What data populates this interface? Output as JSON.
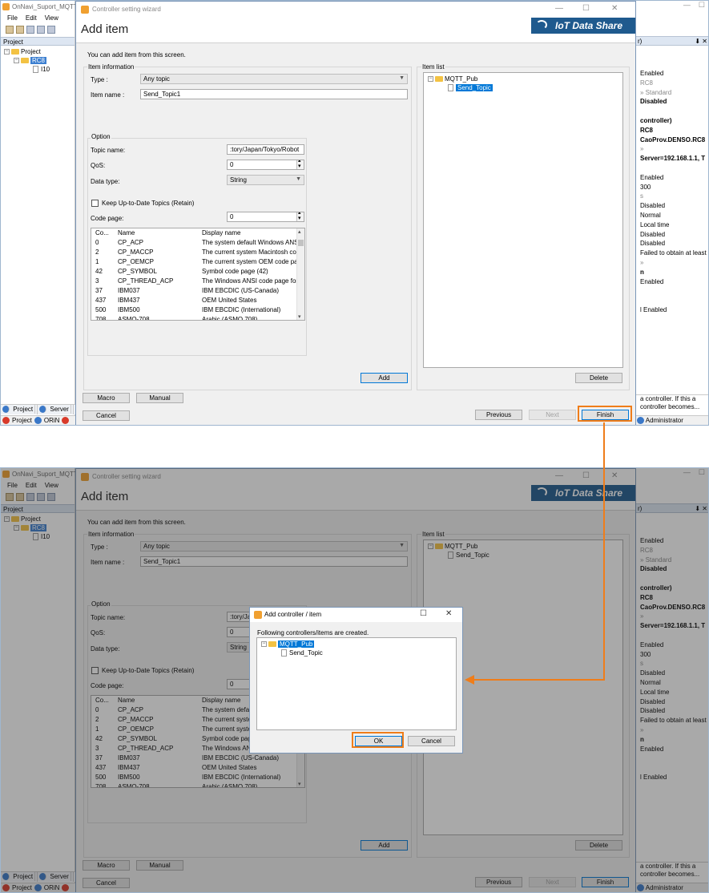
{
  "app": {
    "title": "OnNavi_Suport_MQTT",
    "menu": [
      "File",
      "Edit",
      "View"
    ],
    "project_panel_title": "Project",
    "tree": {
      "root": "Project",
      "controller": "RC8",
      "child": "I10"
    },
    "bottom_tabs": [
      "Project",
      "Server"
    ],
    "status": [
      "Project",
      "ORiN"
    ]
  },
  "props": {
    "title_suffix": "r)",
    "pin": "⬇ ✕",
    "rows": [
      {
        "text": "Enabled",
        "style": ""
      },
      {
        "text": "RC8",
        "style": "g"
      },
      {
        "text": "» Standard",
        "style": "g"
      },
      {
        "text": "Disabled",
        "style": "b"
      },
      {
        "text": "",
        "style": ""
      },
      {
        "text": "controller)",
        "style": "b"
      },
      {
        "text": "RC8",
        "style": "b"
      },
      {
        "text": "CaoProv.DENSO.RC8",
        "style": "b"
      },
      {
        "text": "»",
        "style": "g"
      },
      {
        "text": "Server=192.168.1.1, T",
        "style": "b"
      },
      {
        "text": "",
        "style": ""
      },
      {
        "text": "Enabled",
        "style": ""
      },
      {
        "text": "300",
        "style": ""
      },
      {
        "text": "s",
        "style": "g"
      },
      {
        "text": "Disabled",
        "style": ""
      },
      {
        "text": "Normal",
        "style": ""
      },
      {
        "text": "Local time",
        "style": ""
      },
      {
        "text": "Disabled",
        "style": ""
      },
      {
        "text": "Disabled",
        "style": ""
      },
      {
        "text": "Failed to obtain at least",
        "style": ""
      },
      {
        "text": "»",
        "style": "g"
      },
      {
        "text": "n",
        "style": "b"
      },
      {
        "text": "Enabled",
        "style": ""
      },
      {
        "text": "",
        "style": ""
      },
      {
        "text": "",
        "style": ""
      },
      {
        "text": "l Enabled",
        "style": ""
      }
    ],
    "desc": "a controller. If this a controller becomes...",
    "status": "Administrator"
  },
  "wizard": {
    "title": "Controller setting wizard",
    "heading": "Add item",
    "logo": "IoT Data Share",
    "intro": "You can add item from this screen.",
    "item_info_label": "Item information",
    "type_label": "Type :",
    "type_value": "Any topic",
    "item_name_label": "Item name :",
    "item_name_value": "Send_Topic1",
    "option_label": "Option",
    "topic_name_label": "Topic name:",
    "topic_name_value": ":tory/Japan/Tokyo/Robot",
    "qos_label": "QoS:",
    "qos_value": "0",
    "data_type_label": "Data type:",
    "data_type_value": "String",
    "retain_label": "Keep Up-to-Date Topics (Retain)",
    "code_page_label": "Code page:",
    "code_page_value": "0",
    "code_list": {
      "columns": [
        "Co...",
        "Name",
        "Display name"
      ],
      "rows": [
        [
          "0",
          "CP_ACP",
          "The system default Windows ANSI"
        ],
        [
          "2",
          "CP_MACCP",
          "The current system Macintosh code"
        ],
        [
          "1",
          "CP_OEMCP",
          "The current system OEM code page"
        ],
        [
          "42",
          "CP_SYMBOL",
          "Symbol code page (42)"
        ],
        [
          "3",
          "CP_THREAD_ACP",
          "The Windows ANSI code page for"
        ],
        [
          "37",
          "IBM037",
          "IBM EBCDIC (US-Canada)"
        ],
        [
          "437",
          "IBM437",
          "OEM United States"
        ],
        [
          "500",
          "IBM500",
          "IBM EBCDIC (International)"
        ],
        [
          "708",
          "ASMO-708",
          "Arabic (ASMO 708)"
        ]
      ]
    },
    "add_button": "Add",
    "item_list_label": "Item list",
    "item_tree": {
      "root": "MQTT_Pub",
      "child": "Send_Topic"
    },
    "delete_button": "Delete",
    "macro_button": "Macro",
    "manual_button": "Manual",
    "cancel_button": "Cancel",
    "previous_button": "Previous",
    "next_button": "Next",
    "finish_button": "Finish"
  },
  "window_controls": {
    "minimize": "—",
    "maximize": "☐",
    "close": "✕"
  },
  "dialog": {
    "title": "Add controller / item",
    "message": "Following controllers/items are created.",
    "tree": {
      "root": "MQTT_Pub",
      "child": "Send_Topic"
    },
    "ok_button": "OK",
    "cancel_button": "Cancel"
  },
  "colors": {
    "highlight": "#ef7d1a",
    "selection": "#0078d7",
    "logo_bg": "#1f5a8e"
  }
}
